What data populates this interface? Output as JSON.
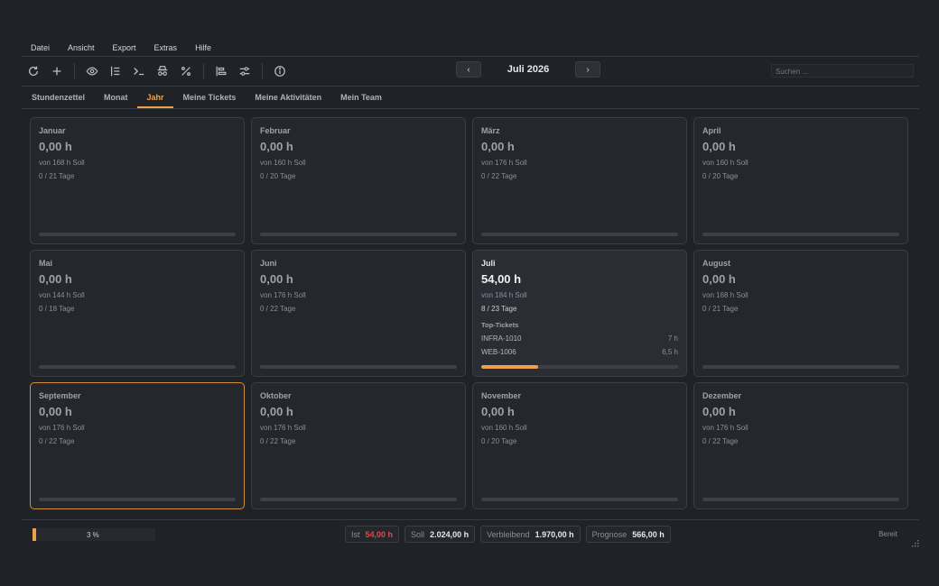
{
  "menu": [
    "Datei",
    "Ansicht",
    "Export",
    "Extras",
    "Hilfe"
  ],
  "toolbar": {
    "buttons": [
      {
        "icon": "refresh-icon"
      },
      {
        "icon": "plus-icon"
      },
      {
        "icon": "eye-icon"
      },
      {
        "icon": "list-icon"
      },
      {
        "icon": "terminal-icon"
      },
      {
        "icon": "spy-icon"
      },
      {
        "icon": "percent-icon"
      },
      {
        "icon": "align-left-icon"
      },
      {
        "icon": "sliders-icon"
      },
      {
        "icon": "info-icon"
      }
    ],
    "prev_label": "‹",
    "next_label": "›",
    "period_title": "Juli 2026",
    "search_placeholder": "Suchen ..."
  },
  "tabs": [
    {
      "label": "Stundenzettel",
      "active": false
    },
    {
      "label": "Monat",
      "active": false
    },
    {
      "label": "Jahr",
      "active": true
    },
    {
      "label": "Meine Tickets",
      "active": false
    },
    {
      "label": "Meine Aktivitäten",
      "active": false
    },
    {
      "label": "Mein Team",
      "active": false
    }
  ],
  "months": [
    {
      "name": "Januar",
      "hours": "0,00 h",
      "soll": "von 168 h Soll",
      "days": "0 / 21 Tage",
      "progress": 0
    },
    {
      "name": "Februar",
      "hours": "0,00 h",
      "soll": "von 160 h Soll",
      "days": "0 / 20 Tage",
      "progress": 0
    },
    {
      "name": "März",
      "hours": "0,00 h",
      "soll": "von 176 h Soll",
      "days": "0 / 22 Tage",
      "progress": 0
    },
    {
      "name": "April",
      "hours": "0,00 h",
      "soll": "von 160 h Soll",
      "days": "0 / 20 Tage",
      "progress": 0
    },
    {
      "name": "Mai",
      "hours": "0,00 h",
      "soll": "von 144 h Soll",
      "days": "0 / 18 Tage",
      "progress": 0
    },
    {
      "name": "Juni",
      "hours": "0,00 h",
      "soll": "von 176 h Soll",
      "days": "0 / 22 Tage",
      "progress": 0
    },
    {
      "name": "Juli",
      "hours": "54,00 h",
      "soll": "von 184 h Soll",
      "days": "8 / 23 Tage",
      "progress": 0.29,
      "current": true,
      "top_tickets_label": "Top-Tickets",
      "top_tickets": [
        {
          "id": "INFRA-1010",
          "hours": "7 h"
        },
        {
          "id": "WEB-1006",
          "hours": "6,5 h"
        }
      ]
    },
    {
      "name": "August",
      "hours": "0,00 h",
      "soll": "von 168 h Soll",
      "days": "0 / 21 Tage",
      "progress": 0
    },
    {
      "name": "September",
      "hours": "0,00 h",
      "soll": "von 176 h Soll",
      "days": "0 / 22 Tage",
      "progress": 0,
      "selected": true
    },
    {
      "name": "Oktober",
      "hours": "0,00 h",
      "soll": "von 176 h Soll",
      "days": "0 / 22 Tage",
      "progress": 0
    },
    {
      "name": "November",
      "hours": "0,00 h",
      "soll": "von 160 h Soll",
      "days": "0 / 20 Tage",
      "progress": 0
    },
    {
      "name": "Dezember",
      "hours": "0,00 h",
      "soll": "von 176 h Soll",
      "days": "0 / 22 Tage",
      "progress": 0
    }
  ],
  "status": {
    "year_progress_text": "3 %",
    "year_progress": 0.03,
    "ist_label": "Ist",
    "ist_value": "54,00 h",
    "soll_label": "Soll",
    "soll_value": "2.024,00 h",
    "remaining_label": "Verbleibend",
    "remaining_value": "1.970,00 h",
    "forecast_label": "Prognose",
    "forecast_value": "566,00 h",
    "state": "Bereit"
  },
  "colors": {
    "accent": "#f0a04b",
    "ist_red": "#e04848",
    "background": "#1f2227"
  }
}
